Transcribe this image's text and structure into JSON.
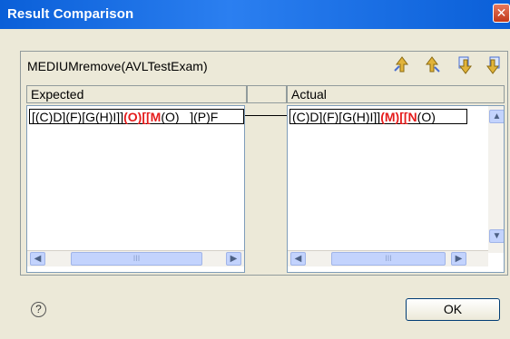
{
  "window": {
    "title": "Result Comparison",
    "close_glyph": "✕"
  },
  "panel": {
    "title": "MEDIUMremove(AVLTestExam)"
  },
  "toolbar": {
    "icons": [
      "diff-first-icon",
      "diff-previous-icon",
      "diff-next-icon",
      "diff-last-icon"
    ]
  },
  "expected": {
    "header": "Expected",
    "content_parts": [
      {
        "text": "[(C)D](F)[G(H)I]]",
        "style": "normal"
      },
      {
        "text": "(O)",
        "style": "red"
      },
      {
        "text": "[[",
        "style": "red"
      },
      {
        "text": "M",
        "style": "red"
      },
      {
        "text": "(O)",
        "style": "normal"
      },
      {
        "text": " _](P)F",
        "style": "normal"
      }
    ]
  },
  "actual": {
    "header": "Actual",
    "content_parts": [
      {
        "text": "(C)D](F)[G(H)I]]",
        "style": "normal"
      },
      {
        "text": "(M)",
        "style": "red"
      },
      {
        "text": "[[",
        "style": "red"
      },
      {
        "text": "N",
        "style": "red"
      },
      {
        "text": "(O)",
        "style": "normal"
      }
    ]
  },
  "scroll": {
    "left_glyph": "◀",
    "right_glyph": "▶",
    "up_glyph": "▲",
    "down_glyph": "▼",
    "grip": "III"
  },
  "footer": {
    "help_glyph": "?",
    "ok_label": "OK"
  },
  "colors": {
    "highlight": "#e51c1c",
    "title_bar": "#0a5fd8"
  }
}
